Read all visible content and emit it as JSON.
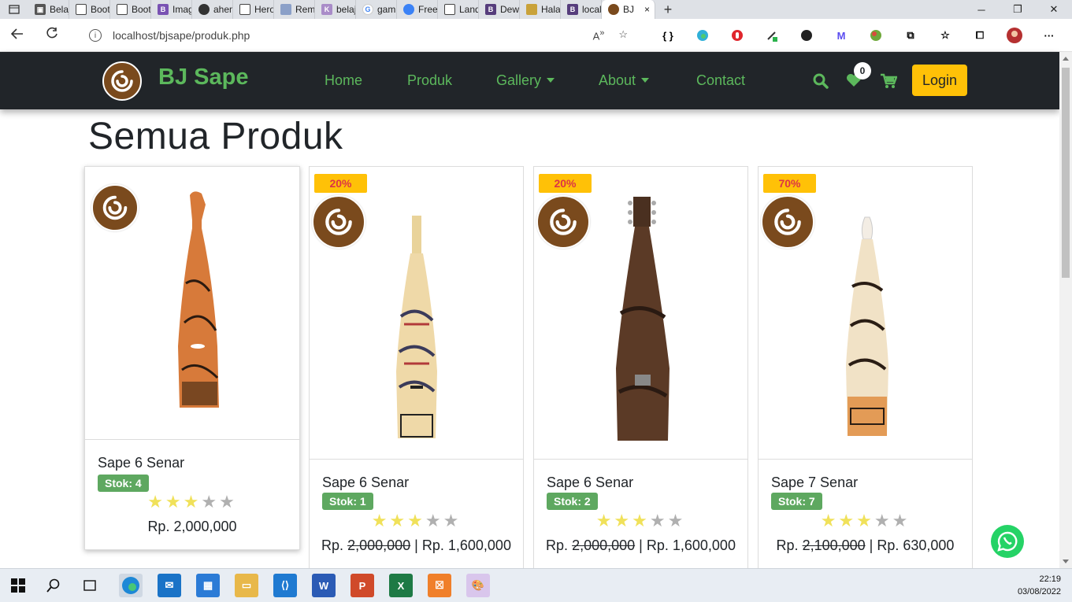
{
  "browser": {
    "tabs": [
      {
        "title": "Belajar",
        "icon": "page-icon"
      },
      {
        "title": "Bootstr",
        "icon": "page-icon"
      },
      {
        "title": "Bootstr",
        "icon": "page-icon"
      },
      {
        "title": "Images",
        "icon": "bootstrap-icon"
      },
      {
        "title": "aheme",
        "icon": "github-icon"
      },
      {
        "title": "Heroku",
        "icon": "page-icon"
      },
      {
        "title": "Remot",
        "icon": "remote-icon"
      },
      {
        "title": "belajar",
        "icon": "k-icon"
      },
      {
        "title": "gamba",
        "icon": "google-icon"
      },
      {
        "title": "Free Pl",
        "icon": "globe-icon"
      },
      {
        "title": "Landin",
        "icon": "page-icon"
      },
      {
        "title": "Dewi E",
        "icon": "bootstrap-icon"
      },
      {
        "title": "Halam",
        "icon": "pencil-icon"
      },
      {
        "title": "localhc",
        "icon": "bootstrap-icon"
      }
    ],
    "active_tab": {
      "title": "BJ",
      "close": "×"
    },
    "new_tab": "+",
    "url": "localhost/bjsape/produk.php",
    "ext_braces": "{ }"
  },
  "site": {
    "brand": "BJ Sape",
    "menu": {
      "home": "Home",
      "produk": "Produk",
      "gallery": "Gallery",
      "about": "About",
      "contact": "Contact"
    },
    "wishlist_count": "0",
    "login": "Login"
  },
  "heading": "Semua Produk",
  "products": [
    {
      "name": "Sape 6 Senar",
      "stock": "Stok: 4",
      "discount": "",
      "rating": 3,
      "price_prefix": "Rp.",
      "old_price": "",
      "sep": "",
      "price": "2,000,000"
    },
    {
      "name": "Sape 6 Senar",
      "stock": "Stok: 1",
      "discount": "20%",
      "rating": 3,
      "price_prefix": "Rp.",
      "old_price": "2,000,000",
      "sep": "| Rp.",
      "price": "1,600,000"
    },
    {
      "name": "Sape 6 Senar",
      "stock": "Stok: 2",
      "discount": "20%",
      "rating": 3,
      "price_prefix": "Rp.",
      "old_price": "2,000,000",
      "sep": "| Rp.",
      "price": "1,600,000"
    },
    {
      "name": "Sape 7 Senar",
      "stock": "Stok: 7",
      "discount": "70%",
      "rating": 3,
      "price_prefix": "Rp.",
      "old_price": "2,100,000",
      "sep": "| Rp.",
      "price": "630,000"
    }
  ],
  "taskbar": {
    "time": "22:19",
    "date": "03/08/2022"
  },
  "colors": {
    "nav_bg": "#212529",
    "brand_green": "#5cb85c",
    "login_yellow": "#ffc107",
    "discount_red": "#dc3545",
    "star_on": "#f0e15a"
  }
}
